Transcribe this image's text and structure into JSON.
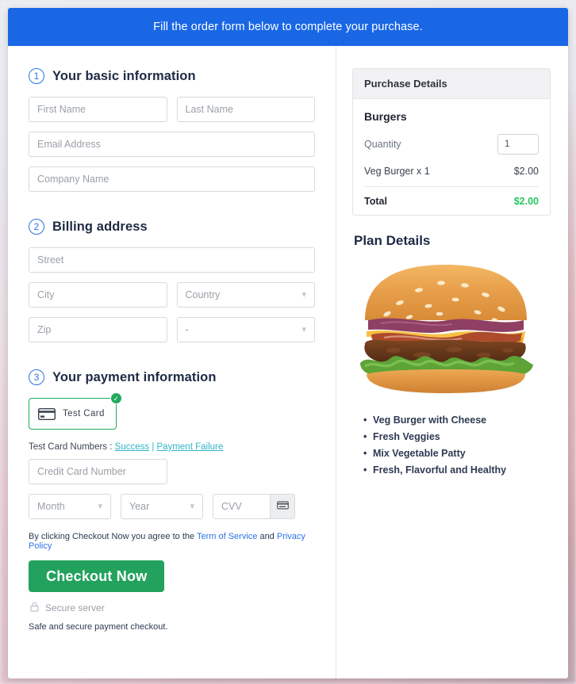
{
  "banner": {
    "text": "Fill the order form below to complete your purchase."
  },
  "sections": {
    "basic": {
      "step": "1",
      "title": "Your basic information",
      "fields": {
        "first_name": "First Name",
        "last_name": "Last Name",
        "email": "Email Address",
        "company": "Company Name"
      }
    },
    "billing": {
      "step": "2",
      "title": "Billing address",
      "fields": {
        "street": "Street",
        "city": "City",
        "country": "Country",
        "zip": "Zip",
        "state": "-"
      }
    },
    "payment": {
      "step": "3",
      "title": "Your payment information",
      "card_tile": {
        "label": "Test  Card",
        "icon": "credit-card-icon",
        "selected_badge": "✓"
      },
      "test_numbers": {
        "prefix": "Test Card Numbers : ",
        "success": "Success",
        "separator": " | ",
        "failure": "Payment Failure"
      },
      "fields": {
        "credit_card_number": "Credit Card Number",
        "month": "Month",
        "year": "Year",
        "cvv": "CVV"
      }
    }
  },
  "terms": {
    "prefix": "By clicking Checkout Now you agree to the ",
    "tos": "Term of Service",
    "conjunction": " and ",
    "privacy": "Privacy Policy"
  },
  "checkout": {
    "button_label": "Checkout Now",
    "secure_label": "Secure server",
    "safe_note": "Safe and secure payment checkout."
  },
  "purchase": {
    "header": "Purchase Details",
    "product": "Burgers",
    "quantity_label": "Quantity",
    "quantity_value": "1",
    "line_item": {
      "label": "Veg Burger x 1",
      "amount": "$2.00"
    },
    "total": {
      "label": "Total",
      "amount": "$2.00"
    }
  },
  "plan": {
    "title": "Plan Details",
    "image_alt": "burger-photo",
    "features": [
      "Veg Burger with Cheese",
      "Fresh Veggies",
      "Mix Vegetable Patty",
      "Fresh, Flavorful and Healthy"
    ]
  },
  "colors": {
    "banner_blue": "#1967e5",
    "accent_blue": "#2a74e8",
    "green_button": "#23a25d",
    "total_green": "#24c760",
    "link_teal": "#30b5c9",
    "card_border_green": "#1faa5d"
  }
}
